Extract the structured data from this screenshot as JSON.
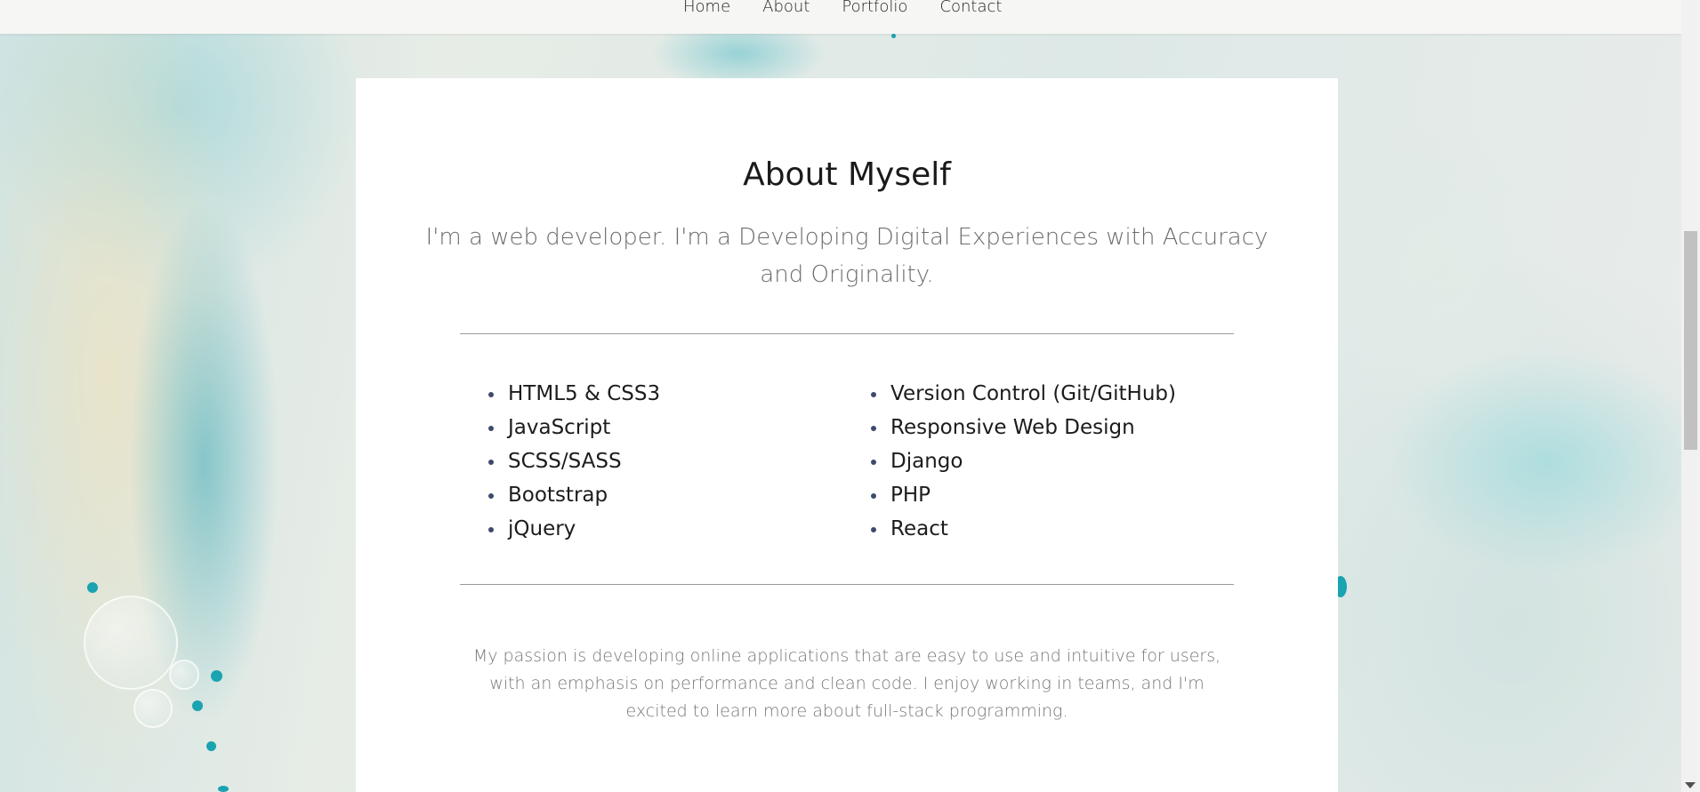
{
  "nav": {
    "items": [
      {
        "label": "Home"
      },
      {
        "label": "About"
      },
      {
        "label": "Portfolio"
      },
      {
        "label": "Contact"
      }
    ]
  },
  "about": {
    "title": "About Myself",
    "subtitle": "I'm a web developer. I'm a Developing Digital Experiences with Accuracy and Originality.",
    "skills_left": [
      "HTML5 & CSS3",
      "JavaScript",
      "SCSS/SASS",
      "Bootstrap",
      "jQuery"
    ],
    "skills_right": [
      "Version Control (Git/GitHub)",
      "Responsive Web Design",
      "Django",
      "PHP",
      "React"
    ],
    "passion": "My passion is developing online applications that are easy to use and intuitive for users, with an emphasis on performance and clean code. I enjoy working in teams, and I'm excited to learn more about full-stack programming."
  },
  "colors": {
    "accent_bullet": "#3d4a6b",
    "card": "#ffffff",
    "navbar": "#f6f6f4"
  }
}
